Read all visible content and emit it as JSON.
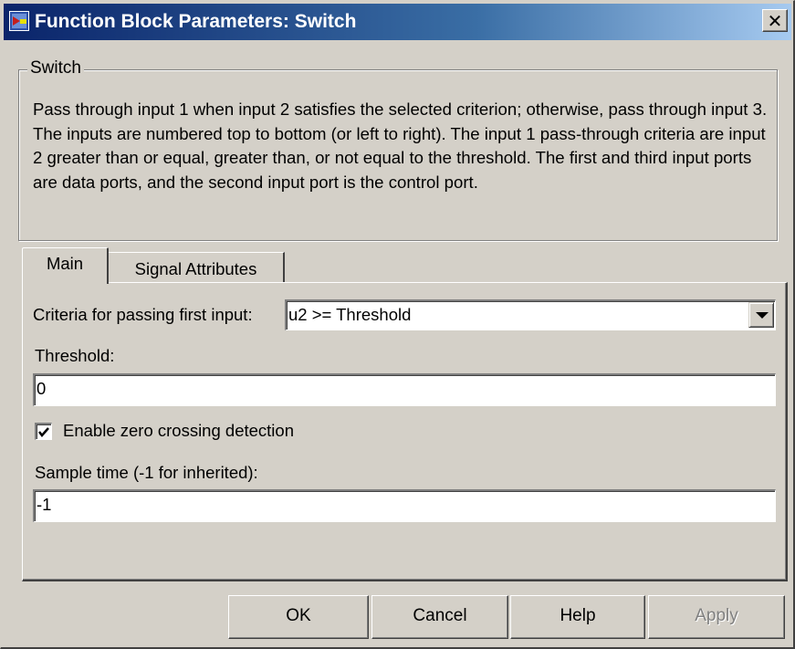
{
  "window": {
    "title": "Function Block Parameters: Switch",
    "close_symbol": "✕",
    "icon": "simulink-block-icon"
  },
  "group": {
    "legend": "Switch",
    "description": "Pass through input 1 when input 2 satisfies the selected criterion; otherwise, pass through input 3.  The inputs are numbered top to bottom (or left to right). The input 1 pass-through criteria are input 2 greater than or equal, greater than, or not equal to the threshold.  The first and third input ports are data ports, and the second input port is the control port."
  },
  "tabs": [
    {
      "label": "Main",
      "active": true
    },
    {
      "label": "Signal Attributes",
      "active": false
    }
  ],
  "main": {
    "criteria_label": "Criteria for passing first input:",
    "criteria_value": "u2 >= Threshold",
    "threshold_label": "Threshold:",
    "threshold_value": "0",
    "zero_crossing_label": "Enable zero crossing detection",
    "zero_crossing_checked": true,
    "sample_time_label": "Sample time (-1 for inherited):",
    "sample_time_value": "-1"
  },
  "buttons": {
    "ok": "OK",
    "cancel": "Cancel",
    "help": "Help",
    "apply": "Apply"
  },
  "colors": {
    "title_gradient_start": "#0a246a",
    "title_gradient_end": "#a6caf0",
    "face": "#d4d0c8",
    "disabled_text": "#808080"
  }
}
